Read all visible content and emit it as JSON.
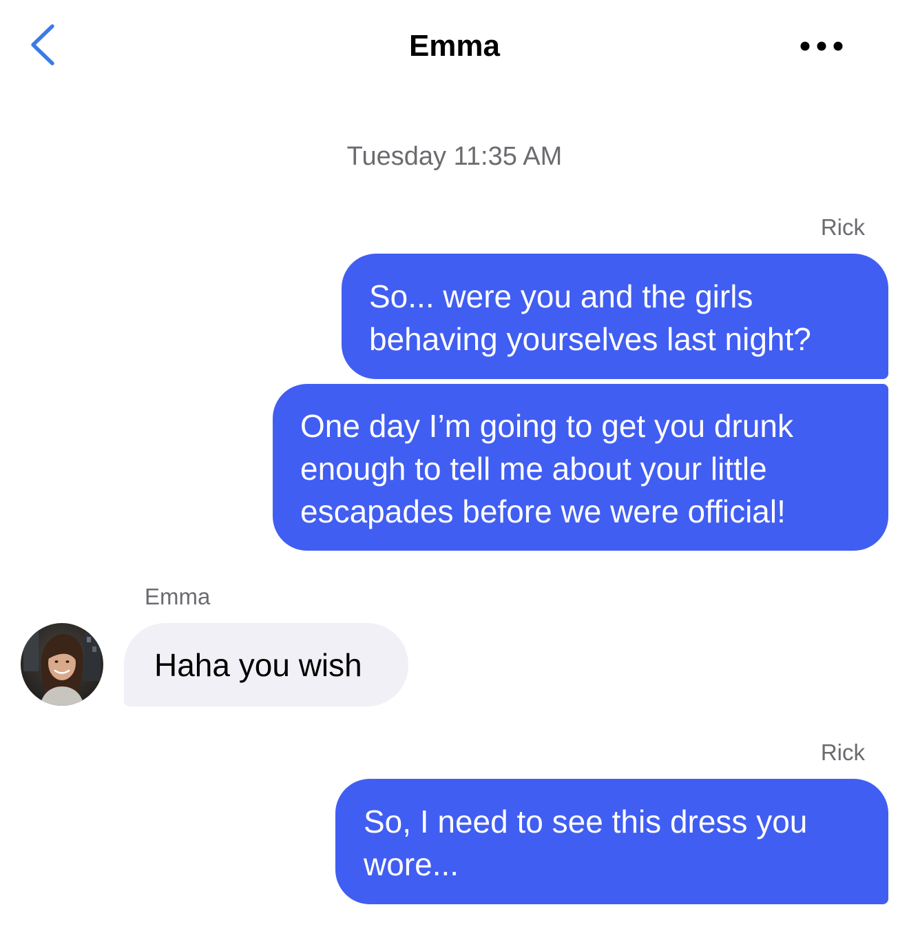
{
  "header": {
    "title": "Emma",
    "back_icon": "chevron-left-icon",
    "more_icon": "ellipsis-icon",
    "accent_color": "#3a7be8"
  },
  "thread": {
    "timestamp": "Tuesday 11:35 AM",
    "outgoing_color": "#415ef2",
    "incoming_color": "#f0f0f6",
    "groups": [
      {
        "sender": "Rick",
        "direction": "outgoing",
        "messages": [
          {
            "lines": [
              "So... were you and the girls",
              "behaving yourselves last night?"
            ]
          },
          {
            "lines": [
              "One day I’m going to get you drunk",
              "enough to tell me about your little",
              "escapades before we were official!"
            ]
          }
        ]
      },
      {
        "sender": "Emma",
        "direction": "incoming",
        "avatar": "contact-avatar-photo",
        "messages": [
          {
            "lines": [
              "Haha you wish"
            ]
          }
        ]
      },
      {
        "sender": "Rick",
        "direction": "outgoing",
        "messages": [
          {
            "lines": [
              "So, I need to see this dress you",
              "wore..."
            ]
          }
        ]
      }
    ]
  }
}
